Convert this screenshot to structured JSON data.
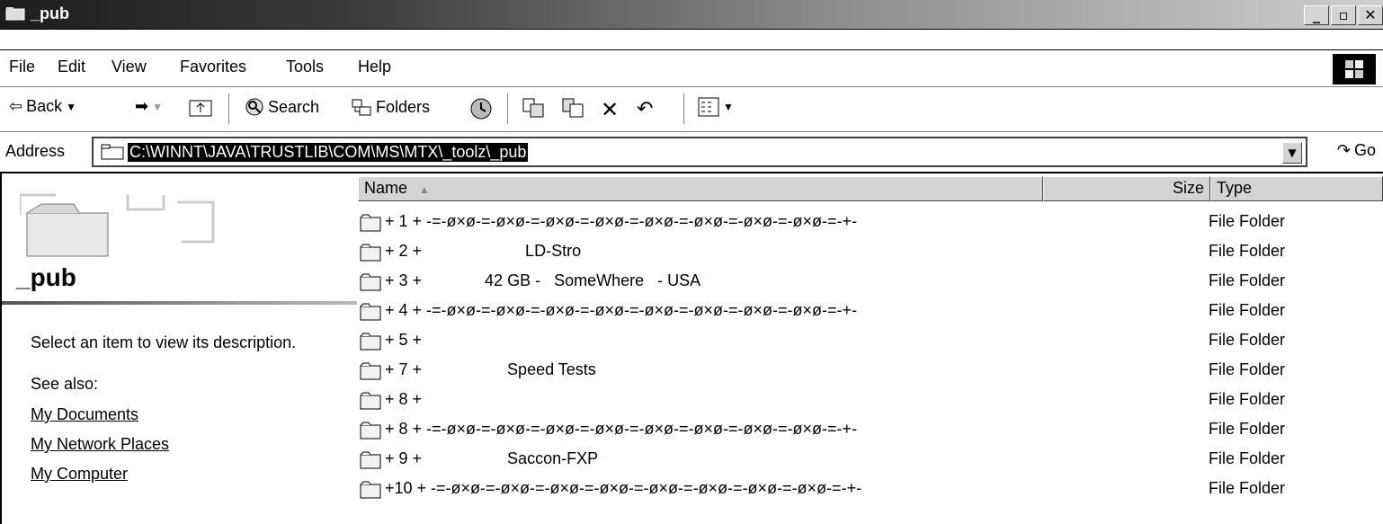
{
  "window": {
    "title": "_pub"
  },
  "menu": [
    {
      "label": "File"
    },
    {
      "label": "Edit"
    },
    {
      "label": "View"
    },
    {
      "label": "Favorites"
    },
    {
      "label": "Tools"
    },
    {
      "label": "Help"
    }
  ],
  "toolbar": {
    "back": "Back",
    "search": "Search",
    "folders": "Folders"
  },
  "address": {
    "label": "Address",
    "path": "C:\\WINNT\\JAVA\\TRUSTLIB\\COM\\MS\\MTX\\_toolz\\_pub",
    "go": "Go"
  },
  "left_panel": {
    "folder_name": "_pub",
    "description": "Select an item to view its description.",
    "see_also": "See also:",
    "links": [
      "My Documents",
      "My Network Places",
      "My Computer"
    ]
  },
  "columns": {
    "name": "Name",
    "size": "Size",
    "type": "Type"
  },
  "files": [
    {
      "name": "+ 1 + -=-ø×ø-=-ø×ø-=-ø×ø-=-ø×ø-=-ø×ø-=-ø×ø-=-ø×ø-=-ø×ø-=-+-",
      "type": "File Folder"
    },
    {
      "name": "+ 2 +                       LD-Stro",
      "type": "File Folder"
    },
    {
      "name": "+ 3 +              42 GB -   SomeWhere   - USA",
      "type": "File Folder"
    },
    {
      "name": "+ 4 + -=-ø×ø-=-ø×ø-=-ø×ø-=-ø×ø-=-ø×ø-=-ø×ø-=-ø×ø-=-ø×ø-=-+-",
      "type": "File Folder"
    },
    {
      "name": "+ 5 +",
      "type": "File Folder"
    },
    {
      "name": "+ 7 +                   Speed Tests",
      "type": "File Folder"
    },
    {
      "name": "+ 8 +",
      "type": "File Folder"
    },
    {
      "name": "+ 8 + -=-ø×ø-=-ø×ø-=-ø×ø-=-ø×ø-=-ø×ø-=-ø×ø-=-ø×ø-=-ø×ø-=-+-",
      "type": "File Folder"
    },
    {
      "name": "+ 9 +                   Saccon-FXP",
      "type": "File Folder"
    },
    {
      "name": "+10 + -=-ø×ø-=-ø×ø-=-ø×ø-=-ø×ø-=-ø×ø-=-ø×ø-=-ø×ø-=-ø×ø-=-+-",
      "type": "File Folder"
    }
  ]
}
